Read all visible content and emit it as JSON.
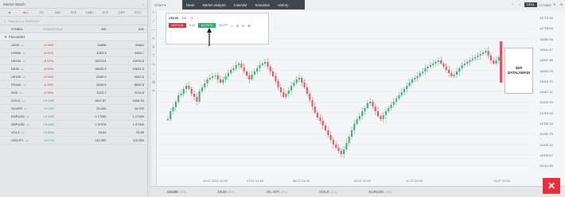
{
  "market_watch": {
    "title": "Market Watch",
    "tabs": [
      "★",
      "ALL",
      "FX",
      "IND",
      "STK",
      "CMD",
      "ETF",
      "CRT",
      "STC"
    ],
    "search_placeholder": "Search e.g. EURUSD",
    "columns": [
      "SYMBOL",
      "CHANGE(%) ▾",
      "BID",
      "ASK"
    ],
    "group": "Favourites",
    "rows": [
      {
        "symbol": "US30",
        "tag": "HA",
        "change": "-0.38%",
        "bid": "34838",
        "ask": "34842",
        "dir": "neg"
      },
      {
        "symbol": "US500",
        "tag": "HA",
        "change": "-0.32%",
        "bid": "4393.3",
        "ask": "4393.7",
        "dir": "neg"
      },
      {
        "symbol": "US100",
        "tag": "HA",
        "change": "-0.17%",
        "bid": "15074.8",
        "ask": "15076.5",
        "dir": "neg"
      },
      {
        "symbol": "DE30",
        "tag": "HA",
        "change": "-0.50%",
        "bid": "15620.3",
        "ask": "15621.5",
        "dir": "neg"
      },
      {
        "symbol": "UK100",
        "tag": "HA",
        "change": "-0.28%",
        "bid": "6940.9",
        "ask": "6942.6",
        "dir": "neg"
      },
      {
        "symbol": "FRA40",
        "tag": "HA",
        "change": "-0.19%",
        "bid": "6549.9",
        "ask": "6550.8",
        "dir": "neg"
      },
      {
        "symbol": "W20",
        "tag": "HA",
        "change": "-0.36%",
        "bid": "2213.7",
        "ask": "2215.9",
        "dir": "neg"
      },
      {
        "symbol": "GOLD",
        "tag": "HA",
        "change": "+0.29%",
        "bid": "1807.87",
        "ask": "1808.33",
        "dir": "pos"
      },
      {
        "symbol": "SILVER",
        "tag": "HA",
        "change": "+0.18%",
        "bid": "25.262",
        "ask": "25.292",
        "dir": "pos"
      },
      {
        "symbol": "EURUSD",
        "tag": "HA",
        "change": "+0.16%",
        "bid": "1.17935",
        "ask": "1.17945",
        "dir": "pos"
      },
      {
        "symbol": "GBPUSD",
        "tag": "HA",
        "change": "+0.16%",
        "bid": "1.37978",
        "ask": "1.37993",
        "dir": "pos"
      },
      {
        "symbol": "VOLX",
        "tag": "HA",
        "change": "+0.82%",
        "bid": "25.69",
        "ask": "25.89",
        "dir": "pos"
      },
      {
        "symbol": "USDJPY",
        "tag": "HA",
        "change": "+0.07%",
        "bid": "110.352",
        "ask": "110.359",
        "dir": "pos"
      }
    ]
  },
  "topbar": {
    "chart_label": "Chart ▾",
    "menu": [
      "News",
      "Market analysis",
      "Calendar",
      "Education",
      "History"
    ],
    "account_type": "REAL",
    "account_id": "1274865"
  },
  "order_box": {
    "symbol": "US100",
    "timeframe": "H1",
    "sell_price": "15074.81",
    "buy_price": "15076.51",
    "volume": "0.10",
    "extra": "SL/TP"
  },
  "y_axis_labels": [
    "14772.25",
    "14728.66",
    "14685.06",
    "14641.47",
    "14597.88",
    "14554.29",
    "14510.70",
    "14467.11",
    "14423.52",
    "14379.93",
    "14336.34",
    "14292.75",
    "14249.16",
    "14205.57",
    "14161.98"
  ],
  "x_axis_labels": [
    "06.07.2021 02:00",
    "07.07 01:00",
    "08.07 01:00",
    "09.07 02:00",
    "12.07 02:00",
    "13.07 02:00"
  ],
  "stop_box": {
    "line1": "SDP",
    "line2": "DATALAMADI"
  },
  "bottom_tabs": [
    {
      "name": "US100",
      "tf": "(H1)"
    },
    {
      "name": "DE30",
      "tf": "(H1)"
    },
    {
      "name": "OIL WTI",
      "tf": "(H1)"
    },
    {
      "name": "GOLD",
      "tf": "(H1)"
    },
    {
      "name": "EURUSD",
      "tf": "(H1)"
    }
  ],
  "colors": {
    "bull": "#3ba776",
    "bear": "#e0505c",
    "accent": "#d0343f",
    "menu_bg": "#3f4650"
  }
}
